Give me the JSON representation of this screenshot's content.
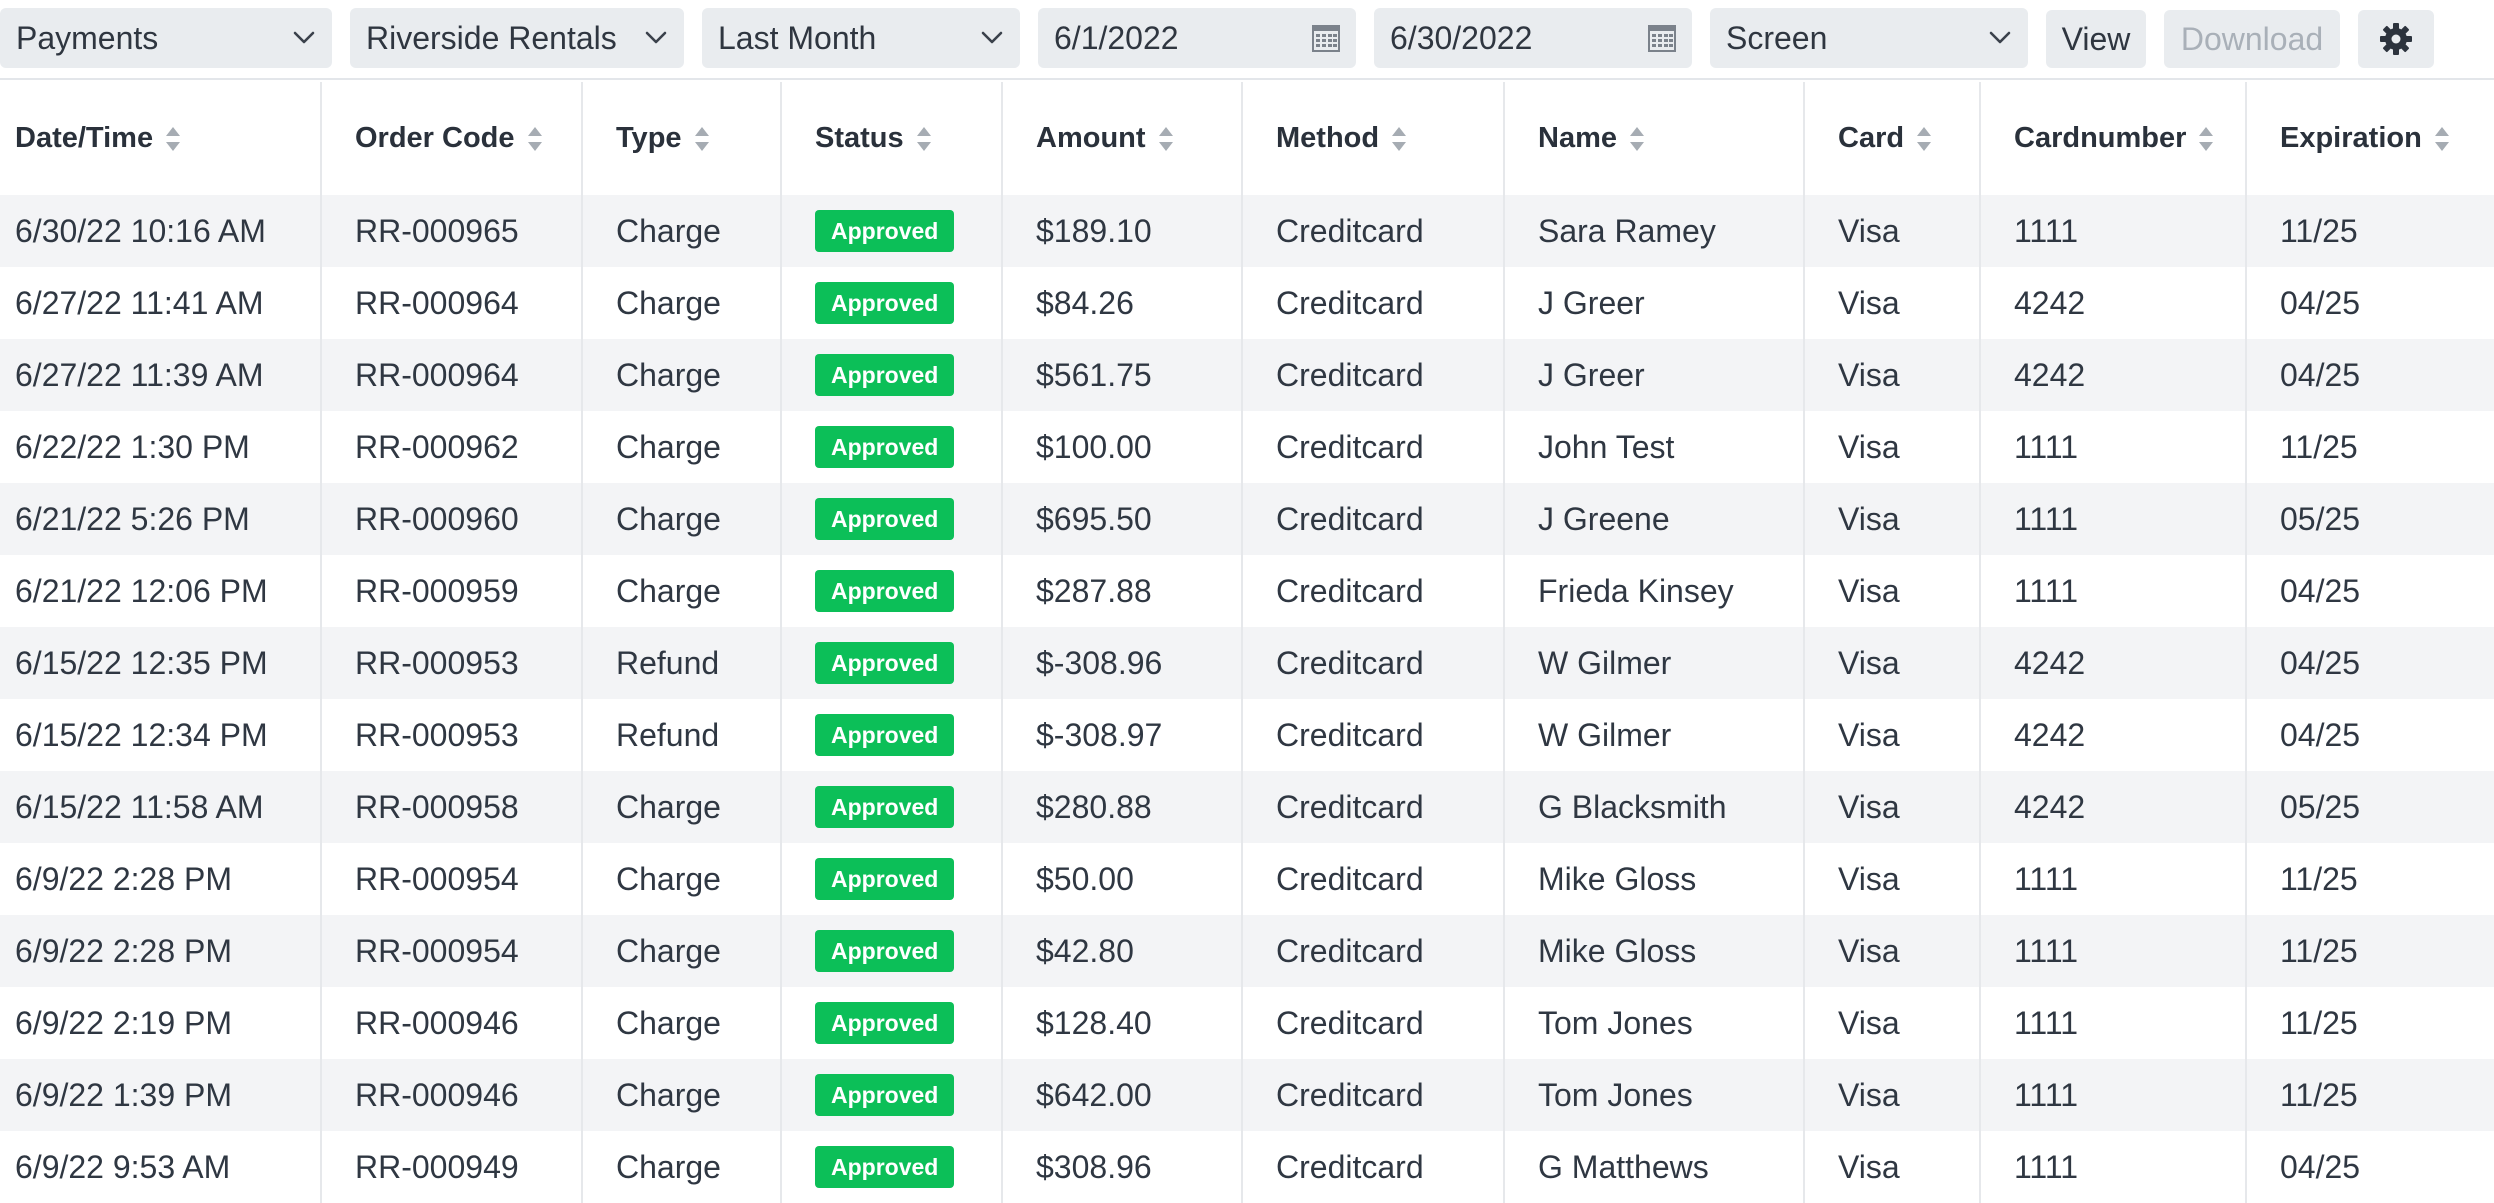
{
  "toolbar": {
    "report_type": "Payments",
    "property": "Riverside Rentals",
    "period": "Last Month",
    "start_date": "6/1/2022",
    "end_date": "6/30/2022",
    "output": "Screen",
    "view_label": "View",
    "download_label": "Download"
  },
  "table": {
    "columns": [
      "Date/Time",
      "Order Code",
      "Type",
      "Status",
      "Amount",
      "Method",
      "Name",
      "Card",
      "Cardnumber",
      "Expiration"
    ],
    "rows": [
      {
        "datetime": "6/30/22 10:16 AM",
        "order": "RR-000965",
        "type": "Charge",
        "status": "Approved",
        "amount": "$189.10",
        "method": "Creditcard",
        "name": "Sara Ramey",
        "card": "Visa",
        "cardnumber": "1111",
        "expiration": "11/25"
      },
      {
        "datetime": "6/27/22 11:41 AM",
        "order": "RR-000964",
        "type": "Charge",
        "status": "Approved",
        "amount": "$84.26",
        "method": "Creditcard",
        "name": "J Greer",
        "card": "Visa",
        "cardnumber": "4242",
        "expiration": "04/25"
      },
      {
        "datetime": "6/27/22 11:39 AM",
        "order": "RR-000964",
        "type": "Charge",
        "status": "Approved",
        "amount": "$561.75",
        "method": "Creditcard",
        "name": "J Greer",
        "card": "Visa",
        "cardnumber": "4242",
        "expiration": "04/25"
      },
      {
        "datetime": "6/22/22 1:30 PM",
        "order": "RR-000962",
        "type": "Charge",
        "status": "Approved",
        "amount": "$100.00",
        "method": "Creditcard",
        "name": "John Test",
        "card": "Visa",
        "cardnumber": "1111",
        "expiration": "11/25"
      },
      {
        "datetime": "6/21/22 5:26 PM",
        "order": "RR-000960",
        "type": "Charge",
        "status": "Approved",
        "amount": "$695.50",
        "method": "Creditcard",
        "name": "J Greene",
        "card": "Visa",
        "cardnumber": "1111",
        "expiration": "05/25"
      },
      {
        "datetime": "6/21/22 12:06 PM",
        "order": "RR-000959",
        "type": "Charge",
        "status": "Approved",
        "amount": "$287.88",
        "method": "Creditcard",
        "name": "Frieda Kinsey",
        "card": "Visa",
        "cardnumber": "1111",
        "expiration": "04/25"
      },
      {
        "datetime": "6/15/22 12:35 PM",
        "order": "RR-000953",
        "type": "Refund",
        "status": "Approved",
        "amount": "$-308.96",
        "method": "Creditcard",
        "name": "W Gilmer",
        "card": "Visa",
        "cardnumber": "4242",
        "expiration": "04/25"
      },
      {
        "datetime": "6/15/22 12:34 PM",
        "order": "RR-000953",
        "type": "Refund",
        "status": "Approved",
        "amount": "$-308.97",
        "method": "Creditcard",
        "name": "W Gilmer",
        "card": "Visa",
        "cardnumber": "4242",
        "expiration": "04/25"
      },
      {
        "datetime": "6/15/22 11:58 AM",
        "order": "RR-000958",
        "type": "Charge",
        "status": "Approved",
        "amount": "$280.88",
        "method": "Creditcard",
        "name": "G Blacksmith",
        "card": "Visa",
        "cardnumber": "4242",
        "expiration": "05/25"
      },
      {
        "datetime": "6/9/22 2:28 PM",
        "order": "RR-000954",
        "type": "Charge",
        "status": "Approved",
        "amount": "$50.00",
        "method": "Creditcard",
        "name": "Mike Gloss",
        "card": "Visa",
        "cardnumber": "1111",
        "expiration": "11/25"
      },
      {
        "datetime": "6/9/22 2:28 PM",
        "order": "RR-000954",
        "type": "Charge",
        "status": "Approved",
        "amount": "$42.80",
        "method": "Creditcard",
        "name": "Mike Gloss",
        "card": "Visa",
        "cardnumber": "1111",
        "expiration": "11/25"
      },
      {
        "datetime": "6/9/22 2:19 PM",
        "order": "RR-000946",
        "type": "Charge",
        "status": "Approved",
        "amount": "$128.40",
        "method": "Creditcard",
        "name": "Tom Jones",
        "card": "Visa",
        "cardnumber": "1111",
        "expiration": "11/25"
      },
      {
        "datetime": "6/9/22 1:39 PM",
        "order": "RR-000946",
        "type": "Charge",
        "status": "Approved",
        "amount": "$642.00",
        "method": "Creditcard",
        "name": "Tom Jones",
        "card": "Visa",
        "cardnumber": "1111",
        "expiration": "11/25"
      },
      {
        "datetime": "6/9/22 9:53 AM",
        "order": "RR-000949",
        "type": "Charge",
        "status": "Approved",
        "amount": "$308.96",
        "method": "Creditcard",
        "name": "G Matthews",
        "card": "Visa",
        "cardnumber": "1111",
        "expiration": "04/25"
      }
    ]
  },
  "colors": {
    "status_approved": "#0cbf58",
    "row_stripe": "#f3f4f6",
    "control_bg": "#e9ecef"
  },
  "icons": {
    "dropdown": "chevron-down-icon",
    "date": "calendar-icon",
    "sort": "sort-icon",
    "settings": "gear-icon"
  }
}
